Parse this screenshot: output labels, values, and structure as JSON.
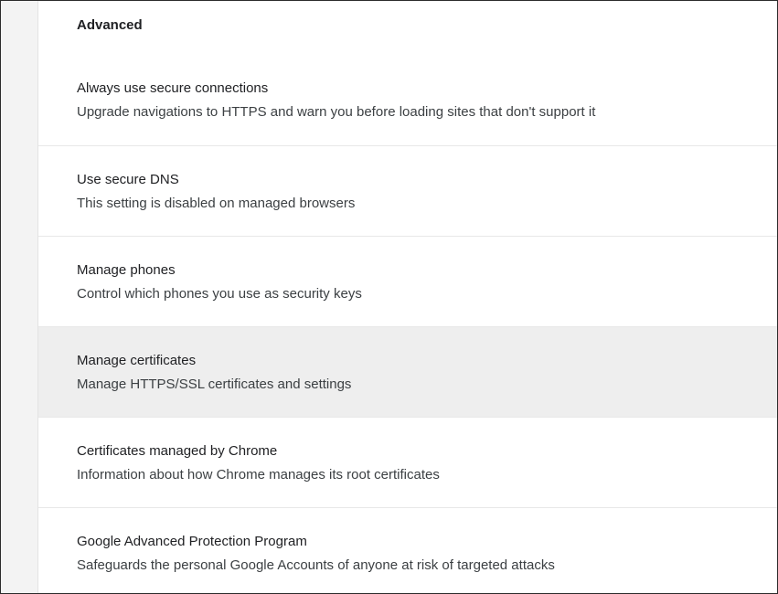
{
  "section": {
    "title": "Advanced"
  },
  "settings": [
    {
      "title": "Always use secure connections",
      "description": "Upgrade navigations to HTTPS and warn you before loading sites that don't support it"
    },
    {
      "title": "Use secure DNS",
      "description": "This setting is disabled on managed browsers"
    },
    {
      "title": "Manage phones",
      "description": "Control which phones you use as security keys"
    },
    {
      "title": "Manage certificates",
      "description": "Manage HTTPS/SSL certificates and settings"
    },
    {
      "title": "Certificates managed by Chrome",
      "description": "Information about how Chrome manages its root certificates"
    },
    {
      "title": "Google Advanced Protection Program",
      "description": "Safeguards the personal Google Accounts of anyone at risk of targeted attacks"
    }
  ],
  "colors": {
    "row_hover": "#eeeeee",
    "text_primary": "#202124",
    "text_secondary": "#3c4043",
    "divider": "#e8e8e8"
  }
}
